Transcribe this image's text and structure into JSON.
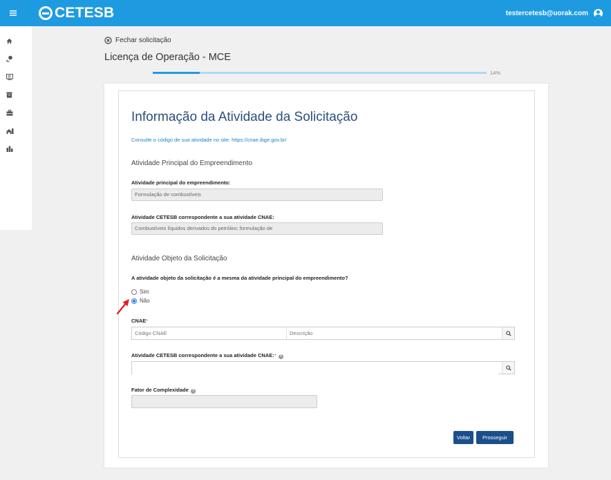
{
  "header": {
    "brand": "CETESB",
    "user_email": "testercetesb@uorak.com",
    "colors": {
      "topbar": "#1e9be0",
      "primary_button": "#1a4f8b",
      "heading": "#2b4f7a"
    }
  },
  "sidebar": {
    "items": [
      {
        "icon": "home-icon"
      },
      {
        "icon": "person-pin-icon"
      },
      {
        "icon": "monitor-search-icon"
      },
      {
        "icon": "archive-icon"
      },
      {
        "icon": "briefcase-icon"
      },
      {
        "icon": "house-building-icon"
      },
      {
        "icon": "city-icon"
      }
    ]
  },
  "page": {
    "close_label": "Fechar solicitação",
    "title": "Licença de Operação - MCE",
    "progress_percent": 14,
    "progress_label": "14%"
  },
  "form": {
    "heading": "Informação da Atividade da Solicitação",
    "hint": "Consulte o código de sua atividade no site: https://cnae.ibge.gov.br/",
    "section_principal": "Atividade Principal do Empreendimento",
    "label_atividade_principal": "Atividade principal do empreendimento:",
    "value_atividade_principal": "Formulação de combustíveis",
    "label_atividade_cetesb": "Atividade CETESB correspondente a sua atividade CNAE:",
    "value_atividade_cetesb": "Combustíveis líquidos derivados do petróleo; formulação de",
    "section_objeto": "Atividade Objeto da Solicitação",
    "question": "A atividade objeto da solicitação é a mesma da atividade principal do empreendimento?",
    "radio_sim": "Sim",
    "radio_nao": "Não",
    "selected_option": "Não",
    "label_cnae": "CNAE",
    "required_mark": "*",
    "placeholder_codigo": "Código CNAE",
    "placeholder_descricao": "Descrição",
    "label_atividade_cetesb_obj": "Atividade CETESB correspondente a sua atividade CNAE:",
    "label_fator": "Fator de Complexidade",
    "value_fator": "",
    "btn_voltar": "Voltar",
    "btn_prosseguir": "Prosseguir"
  }
}
